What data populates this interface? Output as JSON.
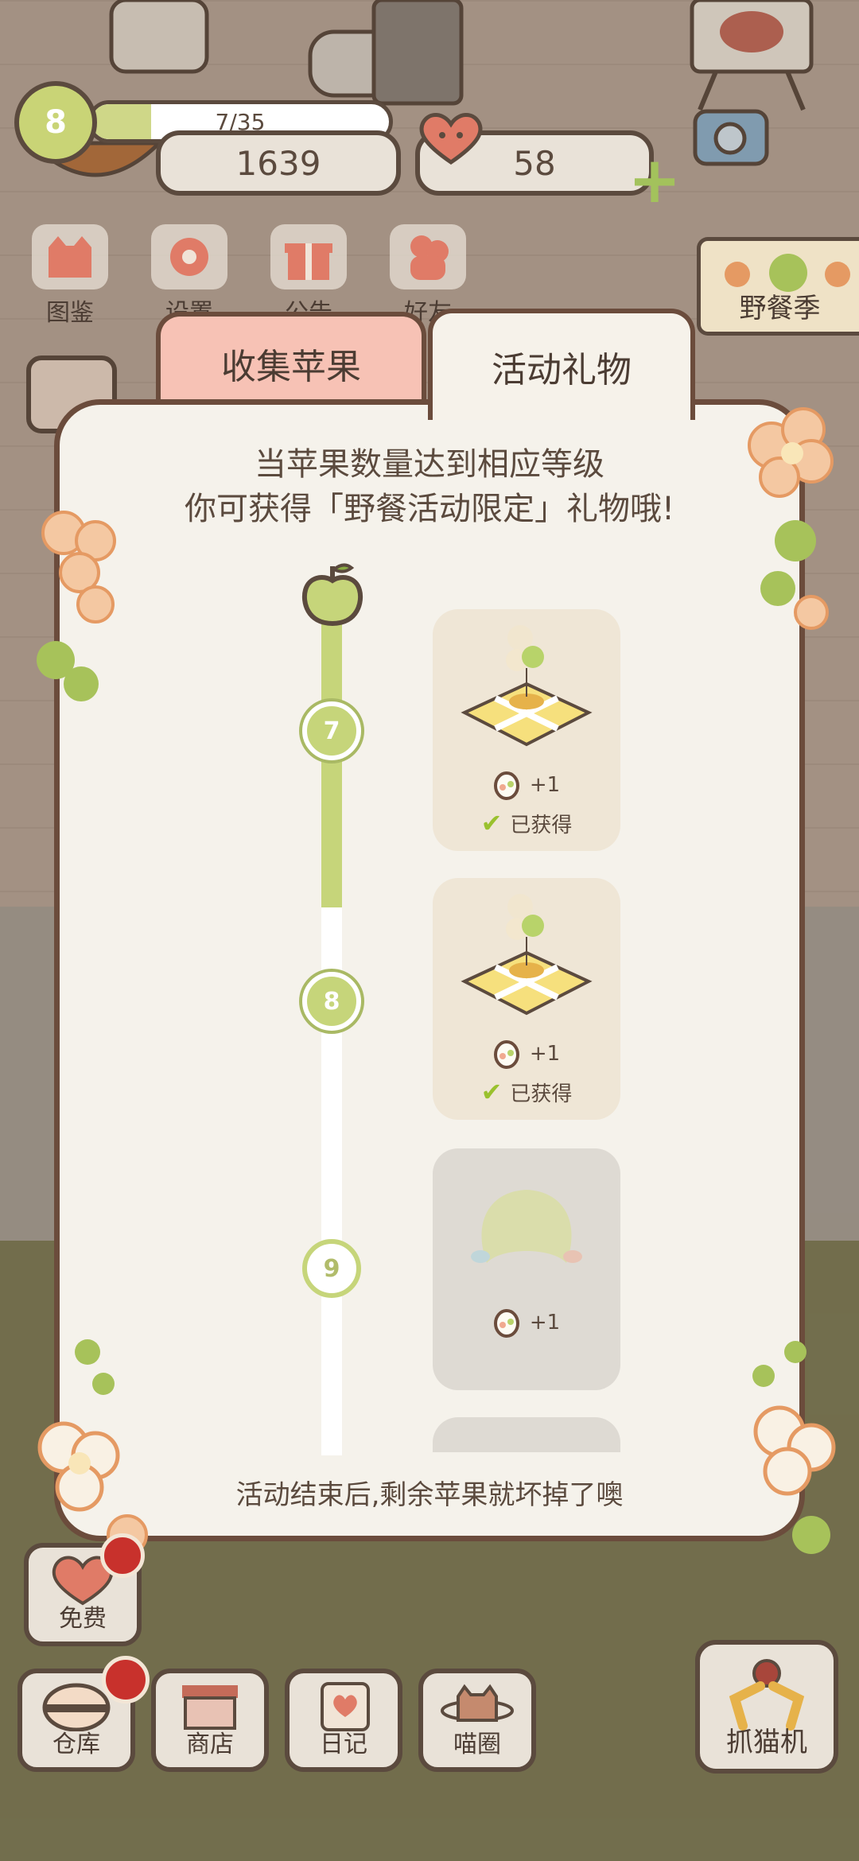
{
  "hud": {
    "level": "8",
    "xp_text": "7/35",
    "xp_progress": 0.2,
    "coins": "1639",
    "hearts": "58"
  },
  "top_menu": [
    {
      "label": "图鉴",
      "icon": "cat-book-icon"
    },
    {
      "label": "设置",
      "icon": "gear-icon"
    },
    {
      "label": "公告",
      "icon": "gift-icon"
    },
    {
      "label": "好友",
      "icon": "friends-icon"
    }
  ],
  "event_flag": {
    "label": "野餐季"
  },
  "modal": {
    "tabs": [
      {
        "label": "收集苹果",
        "active": false
      },
      {
        "label": "活动礼物",
        "active": true
      }
    ],
    "description_line1": "当苹果数量达到相应等级",
    "description_line2": "你可获得「野餐活动限定」礼物哦!",
    "progress_fill": 0.35,
    "rewards": [
      {
        "level": "7",
        "count": "+1",
        "status": "已获得",
        "obtained": true
      },
      {
        "level": "8",
        "count": "+1",
        "status": "已获得",
        "obtained": true
      },
      {
        "level": "9",
        "count": "+1",
        "status": "",
        "obtained": false
      }
    ],
    "footer": "活动结束后,剩余苹果就坏掉了噢"
  },
  "bottom_bar": {
    "free_label": "免费",
    "warehouse_label": "仓库",
    "shop_label": "商店",
    "diary_label": "日记",
    "circle_label": "喵圈",
    "claw_label": "抓猫机"
  },
  "colors": {
    "accent_green": "#c6d57a",
    "tab_pink": "#f7c2b5",
    "outline_brown": "#6b4c3c",
    "badge_red": "#c8312c"
  }
}
